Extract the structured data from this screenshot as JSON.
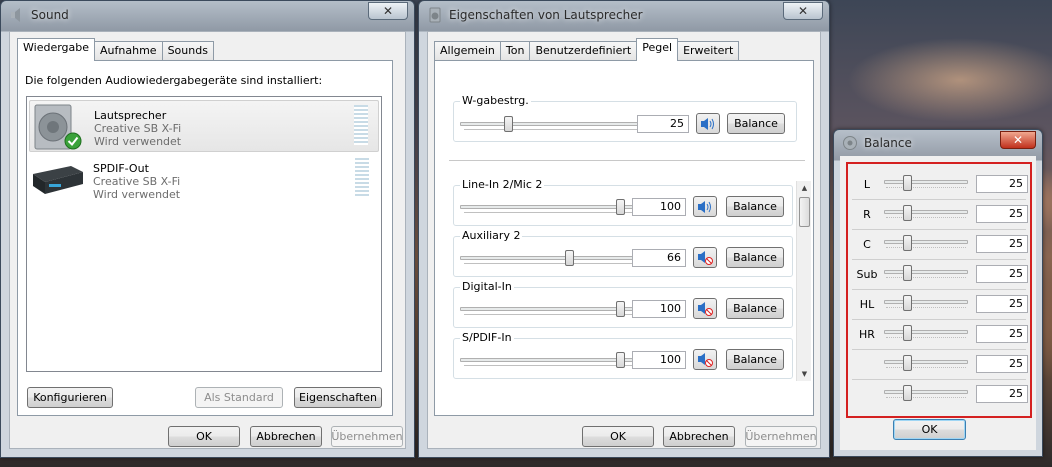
{
  "sound_window": {
    "title": "Sound",
    "close_glyph": "✕",
    "tabs": [
      "Wiedergabe",
      "Aufnahme",
      "Sounds"
    ],
    "active_tab": "Wiedergabe",
    "description": "Die folgenden Audiowiedergabegeräte sind installiert:",
    "devices": [
      {
        "name": "Lautsprecher",
        "detail": "Creative SB X-Fi",
        "status": "Wird verwendet",
        "icon": "speaker-icon",
        "selected": true,
        "default_badge": "check-icon"
      },
      {
        "name": "SPDIF-Out",
        "detail": "Creative SB X-Fi",
        "status": "Wird verwendet",
        "icon": "spdif-device-icon",
        "selected": false
      }
    ],
    "buttons": {
      "configure": "Konfigurieren",
      "set_default": "Als Standard",
      "properties": "Eigenschaften"
    },
    "footer": {
      "ok": "OK",
      "cancel": "Abbrechen",
      "apply": "Übernehmen"
    }
  },
  "props_window": {
    "title": "Eigenschaften von Lautsprecher",
    "close_glyph": "✕",
    "tabs": [
      "Allgemein",
      "Ton",
      "Benutzerdefiniert",
      "Pegel",
      "Erweitert"
    ],
    "active_tab": "Pegel",
    "master": {
      "label": "W-gabestrg.",
      "value": "25",
      "level": 25,
      "balance_label": "Balance",
      "muted": false
    },
    "channels": [
      {
        "label": "Line-In 2/Mic 2",
        "value": "100",
        "level": 100,
        "balance_label": "Balance",
        "muted": false
      },
      {
        "label": "Auxiliary 2",
        "value": "66",
        "level": 66,
        "balance_label": "Balance",
        "muted": true
      },
      {
        "label": "Digital-In",
        "value": "100",
        "level": 100,
        "balance_label": "Balance",
        "muted": true
      },
      {
        "label": "S/PDIF-In",
        "value": "100",
        "level": 100,
        "balance_label": "Balance",
        "muted": true
      }
    ],
    "footer": {
      "ok": "OK",
      "cancel": "Abbrechen",
      "apply": "Übernehmen"
    }
  },
  "balance_window": {
    "title": "Balance",
    "close_glyph": "✕",
    "rows": [
      {
        "label": "L",
        "value": "25",
        "level": 25
      },
      {
        "label": "R",
        "value": "25",
        "level": 25
      },
      {
        "label": "C",
        "value": "25",
        "level": 25
      },
      {
        "label": "Sub",
        "value": "25",
        "level": 25
      },
      {
        "label": "HL",
        "value": "25",
        "level": 25
      },
      {
        "label": "HR",
        "value": "25",
        "level": 25
      },
      {
        "label": "",
        "value": "25",
        "level": 25
      },
      {
        "label": "",
        "value": "25",
        "level": 25
      }
    ],
    "ok_label": "OK",
    "highlight_color": "#d42020"
  }
}
